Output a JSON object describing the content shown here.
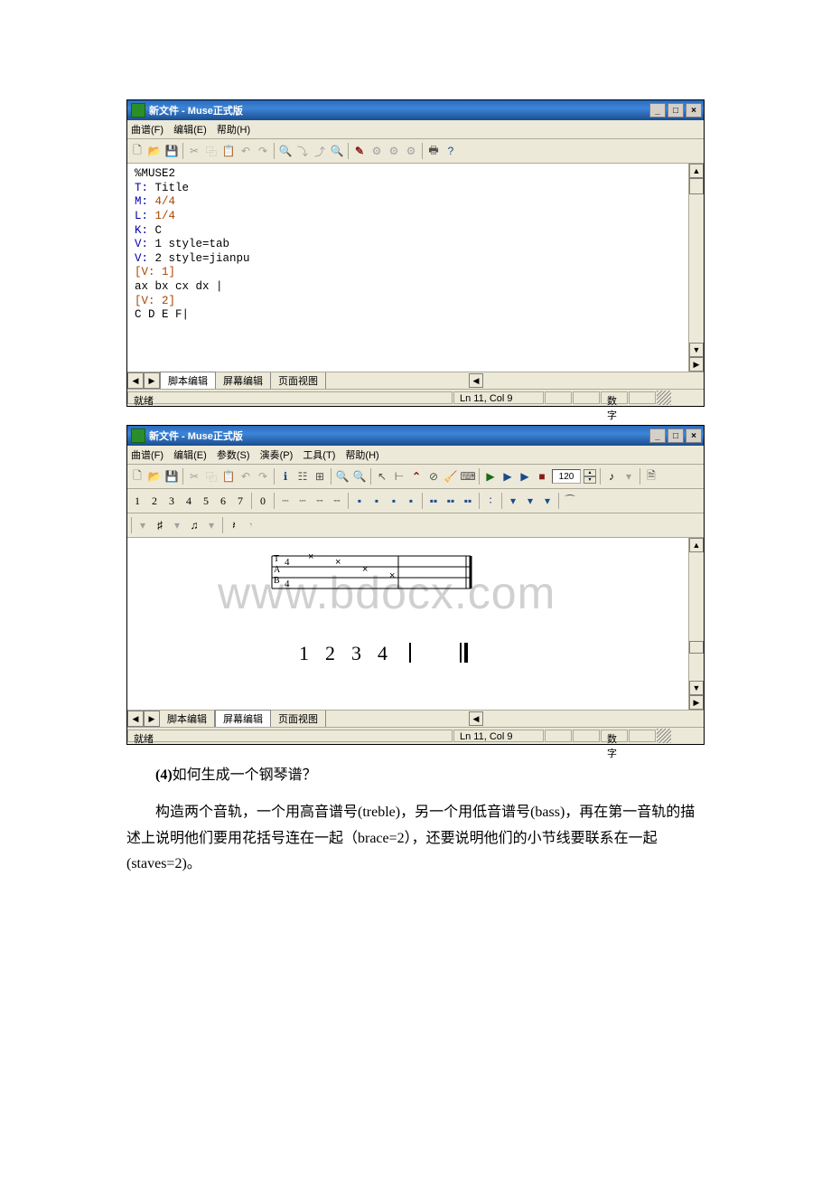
{
  "window1": {
    "title": "新文件 - Muse正式版",
    "menus": [
      "曲谱(F)",
      "编辑(E)",
      "帮助(H)"
    ],
    "code": {
      "l1": "%MUSE2",
      "l2a": "T:",
      "l2b": " Title",
      "l3a": "M:",
      "l3b": " 4/4",
      "l4a": "L:",
      "l4b": " 1/4",
      "l5a": "K:",
      "l5b": " C",
      "l6a": "V:",
      "l6b": " 1 style=tab",
      "l7a": "V:",
      "l7b": " 2 style=jianpu",
      "l8": "[V: 1]",
      "l9": "ax bx cx dx |",
      "l10": "[V: 2]",
      "l11": "C D E F|",
      "l11cursor": "|"
    },
    "tabs": [
      "脚本编辑",
      "屏幕编辑",
      "页面视图"
    ],
    "status": {
      "ready": "就绪",
      "pos": "Ln 11, Col 9",
      "numlock": "数字"
    }
  },
  "window2": {
    "title": "新文件 - Muse正式版",
    "menus": [
      "曲谱(F)",
      "编辑(E)",
      "参数(S)",
      "演奏(P)",
      "工具(T)",
      "帮助(H)"
    ],
    "tempo": "120",
    "nums": [
      "1",
      "2",
      "3",
      "4",
      "5",
      "6",
      "7",
      "0"
    ],
    "tab_labels": [
      "T",
      "A",
      "B"
    ],
    "tab_ts": "4",
    "jianpu": "1234",
    "tabs": [
      "脚本编辑",
      "屏幕编辑",
      "页面视图"
    ],
    "status": {
      "ready": "就绪",
      "pos": "Ln 11, Col 9",
      "numlock": "数字"
    },
    "watermark": "www.bdocx.com"
  },
  "doc": {
    "heading_num": "(4)",
    "heading": "如何生成一个钢琴谱？",
    "para": "构造两个音轨，一个用高音谱号(treble)，另一个用低音谱号(bass)，再在第一音轨的描述上说明他们要用花括号连在一起（brace=2），还要说明他们的小节线要联系在一起(staves=2)。"
  }
}
